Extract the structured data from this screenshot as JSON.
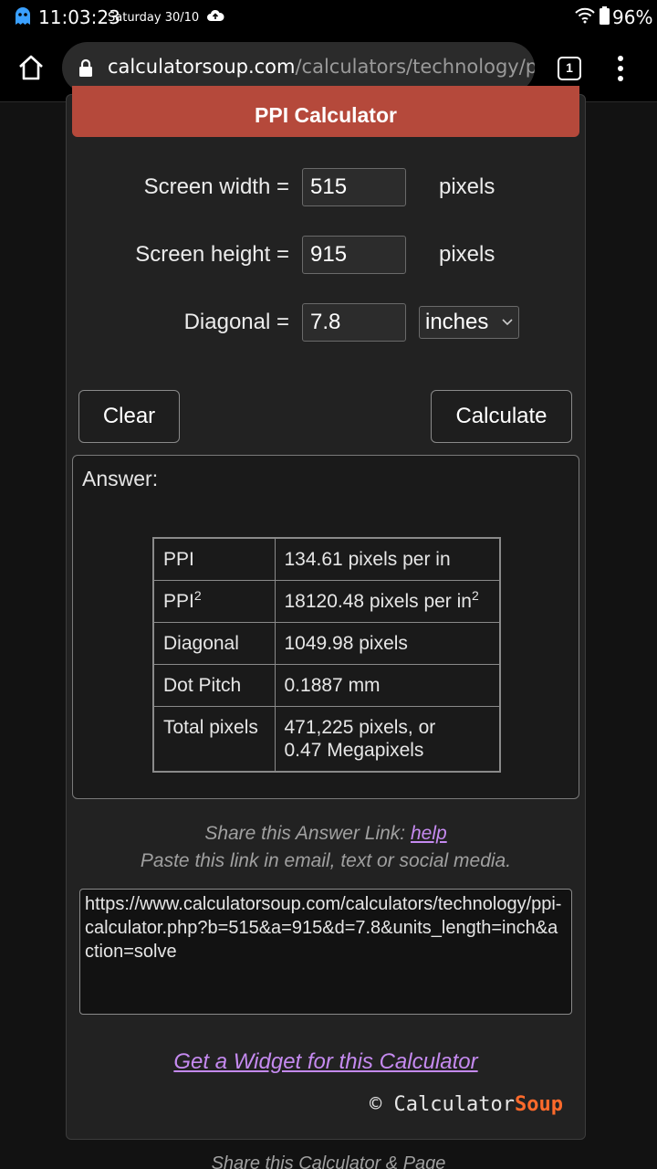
{
  "status_bar": {
    "time": "11:03:23",
    "date": "Saturday 30/10",
    "battery": "96%",
    "icons": [
      "ghost-app-icon",
      "cloud-upload-icon",
      "wifi-icon",
      "battery-icon"
    ]
  },
  "browser": {
    "url_host": "calculatorsoup.com",
    "url_path": "/calculators/technology/ppi-",
    "tab_count": "1",
    "icons": [
      "home-icon",
      "lock-icon",
      "more-vert-icon"
    ]
  },
  "calculator": {
    "title": "PPI Calculator",
    "width_label": "Screen width =",
    "width_value": "515",
    "width_unit": "pixels",
    "height_label": "Screen height =",
    "height_value": "915",
    "height_unit": "pixels",
    "diagonal_label": "Diagonal =",
    "diagonal_value": "7.8",
    "diagonal_unit": "inches",
    "clear_label": "Clear",
    "calculate_label": "Calculate"
  },
  "answer": {
    "label": "Answer:",
    "rows": [
      {
        "key": "PPI",
        "value": "134.61 pixels per in"
      },
      {
        "key": "PPI",
        "key_sup": "2",
        "value": "18120.48 pixels per in",
        "value_sup": "2"
      },
      {
        "key": "Diagonal",
        "value": "1049.98 pixels"
      },
      {
        "key": "Dot Pitch",
        "value": "0.1887 mm"
      },
      {
        "key": "Total pixels",
        "value": "471,225 pixels, or",
        "value2": "0.47 Megapixels"
      }
    ]
  },
  "share": {
    "line1": "Share this Answer Link:",
    "help": "help",
    "line2": "Paste this link in email, text or social media.",
    "link": "https://www.calculatorsoup.com/calculators/technology/ppi-calculator.php?b=515&a=915&d=7.8&units_length=inch&action=solve",
    "widget": "Get a Widget for this Calculator",
    "copyright": "©",
    "brand_a": "Calculator",
    "brand_b": "Soup"
  },
  "below": "Share this Calculator & Page"
}
